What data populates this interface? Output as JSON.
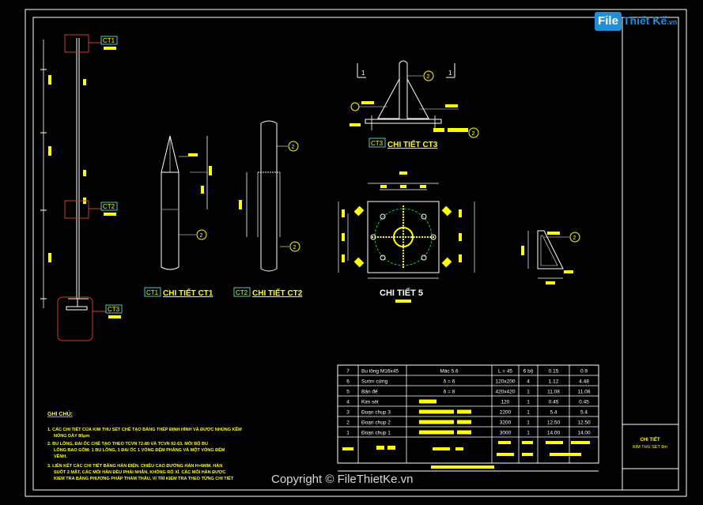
{
  "brand": {
    "box_text": "File",
    "rest_text": "Thiết Kế",
    "suffix": ".vn"
  },
  "watermark": "Copyright © FileThietKe.vn",
  "tags": {
    "ct1": "CT1",
    "ct2": "CT2",
    "ct3": "CT3"
  },
  "details": {
    "ct1_title": "CHI TIẾT CT1",
    "ct2_title": "CHI TIẾT CT2",
    "ct3_title": "CHI TIẾT CT3",
    "detail5_title": "CHI TIẾT 5"
  },
  "section_mark": "1",
  "bubble_mark": "2",
  "notes": {
    "heading": "GHI CHÚ:",
    "lines": [
      "1. CÁC CHI TIẾT CỦA KIM THU SÉT CHẾ TẠO BẰNG THÉP ĐỊNH HÌNH VÀ ĐƯỢC NHÚNG KẼM",
      "NÓNG DÀY 80μm",
      "2. BU LÔNG, ĐAI ỐC CHẾ TẠO THEO TCVN 72-80 VÀ TCVN 92-63. MỖI BỘ BU",
      "LÔNG BAO GỒM: 1 BU LÔNG, 1 ĐAI ỐC 1 VÒNG ĐỆM PHẲNG VÀ MỘT VÒNG ĐỆM",
      "VÊNH.",
      "3. LIÊN KẾT CÁC CHI TIẾT BẰNG HÀN ĐIỆN. CHIỀU CAO ĐƯỜNG HÀN H=6MM. HÀN",
      "SUỐT 2 MẶT, CÁC MỐI HÀN ĐỀU PHẢI NHẴN, KHÔNG RỖ XỈ. CÁC MỐI HÀN ĐƯỢC",
      "KIỂM TRA BẰNG PHƯƠNG PHÁP THẨM THẤU, VỊ TRÍ KIỂM TRA THEO TỪNG CHI TIẾT"
    ]
  },
  "bom": {
    "rows": [
      {
        "no": "7",
        "name": "Bu lông M16x45",
        "spec": "Mác 5.6",
        "size": "L = 45",
        "qty": "6 bộ",
        "unit_w": "0.15",
        "total_w": "0.9"
      },
      {
        "no": "6",
        "name": "Sườn cứng",
        "spec": "δ = 6",
        "size": "120x200",
        "qty": "4",
        "unit_w": "1.12",
        "total_w": "4.48"
      },
      {
        "no": "5",
        "name": "Bản đế",
        "spec": "δ = 8",
        "size": "420x420",
        "qty": "1",
        "unit_w": "11.08",
        "total_w": "11.08"
      },
      {
        "no": "4",
        "name": "Kim sét",
        "spec": "",
        "size": "120",
        "qty": "1",
        "unit_w": "0.45",
        "total_w": "0.45"
      },
      {
        "no": "3",
        "name": "Đoạn chụp 3",
        "spec": "",
        "size": "2200",
        "qty": "1",
        "unit_w": "5.4",
        "total_w": "5.4"
      },
      {
        "no": "2",
        "name": "Đoạn chụp 2",
        "spec": "",
        "size": "3200",
        "qty": "1",
        "unit_w": "12.50",
        "total_w": "12.50"
      },
      {
        "no": "1",
        "name": "Đoạn chụp 1",
        "spec": "",
        "size": "3000",
        "qty": "1",
        "unit_w": "14.00",
        "total_w": "14.00"
      }
    ]
  },
  "title_block": {
    "line1": "CHI TIẾT",
    "line2": "KIM THU SÉT 8m"
  },
  "colors": {
    "frame": "#ffffff",
    "profile": "#ffffff",
    "tag_red": "#d23a2a",
    "tag_box": "#4ec7c7",
    "tag_text": "#ffff00",
    "annotation": "#ffff00",
    "plate_green": "#2bbf3a",
    "watermark": "#d8d8d8",
    "brand_blue": "#1f8fd8"
  }
}
